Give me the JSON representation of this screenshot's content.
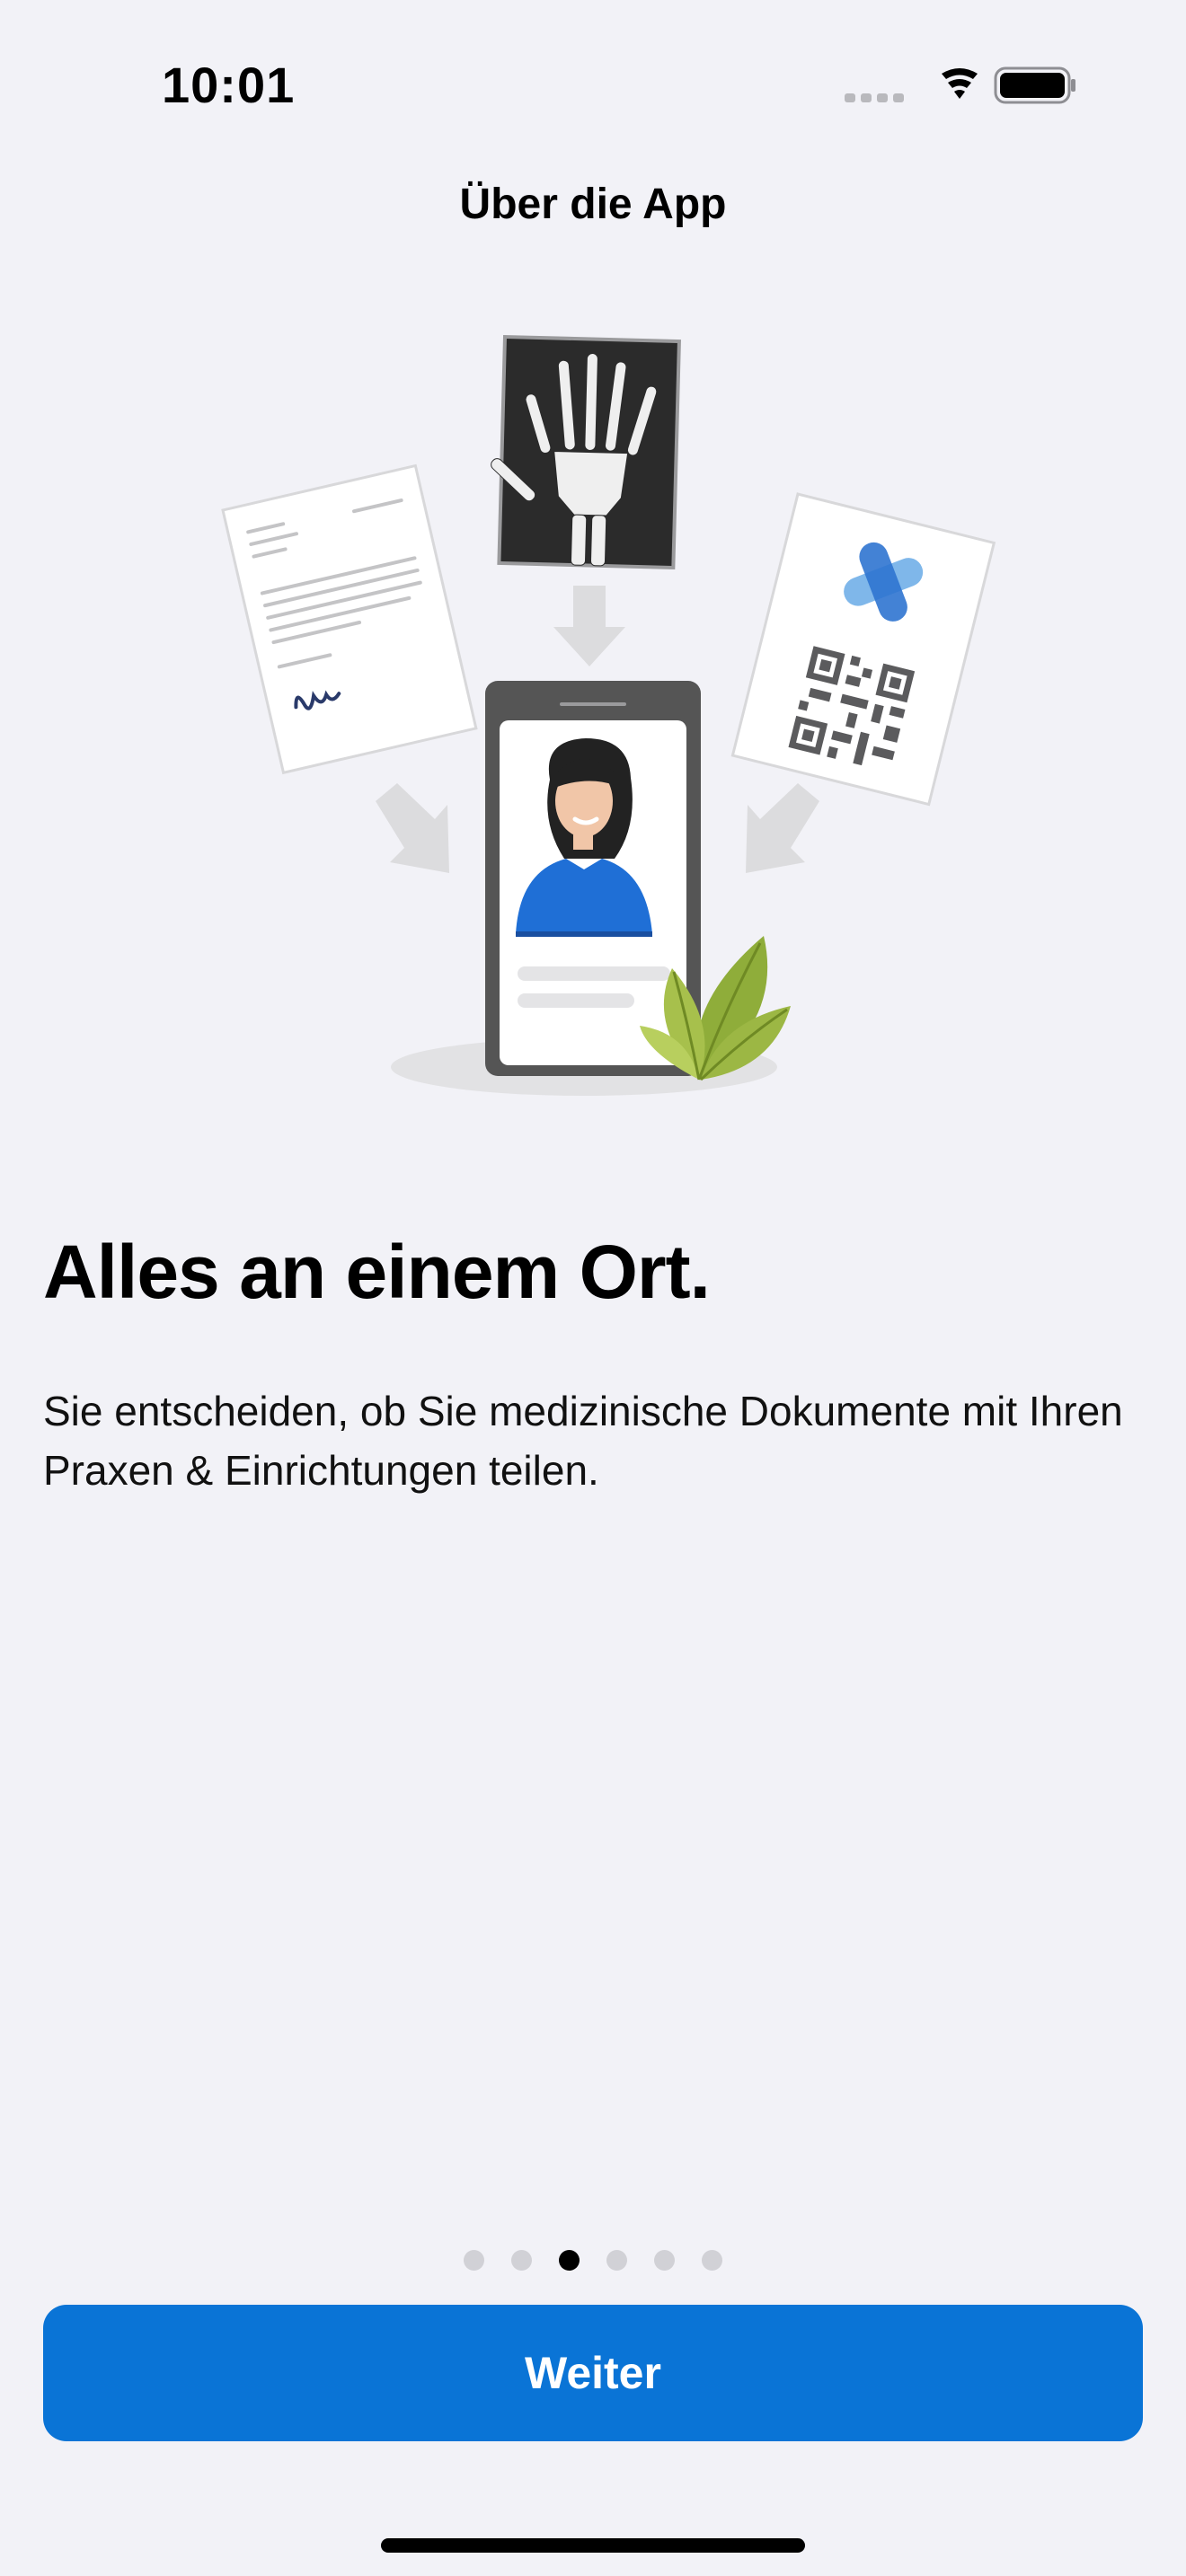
{
  "status_bar": {
    "time": "10:01",
    "icons": [
      "signal-dots-icon",
      "wifi-icon",
      "battery-icon"
    ]
  },
  "nav": {
    "title": "Über die App"
  },
  "illustration": {
    "subject": "documents-to-phone-illustration",
    "colors": {
      "accent_blue": "#1f6fd6",
      "leaf_green": "#8fad3a",
      "phone_gray": "#555555",
      "xray_bg": "#2b2b2b"
    }
  },
  "content": {
    "headline": "Alles an einem Ort.",
    "description": "Sie entscheiden, ob Sie medizinische Dokumente mit Ihren Praxen & Einrichtungen teilen."
  },
  "pager": {
    "total": 6,
    "current": 3
  },
  "actions": {
    "continue_label": "Weiter"
  },
  "colors": {
    "background": "#f2f2f7",
    "primary_button": "#0a74d6",
    "primary_button_text": "#ffffff"
  }
}
